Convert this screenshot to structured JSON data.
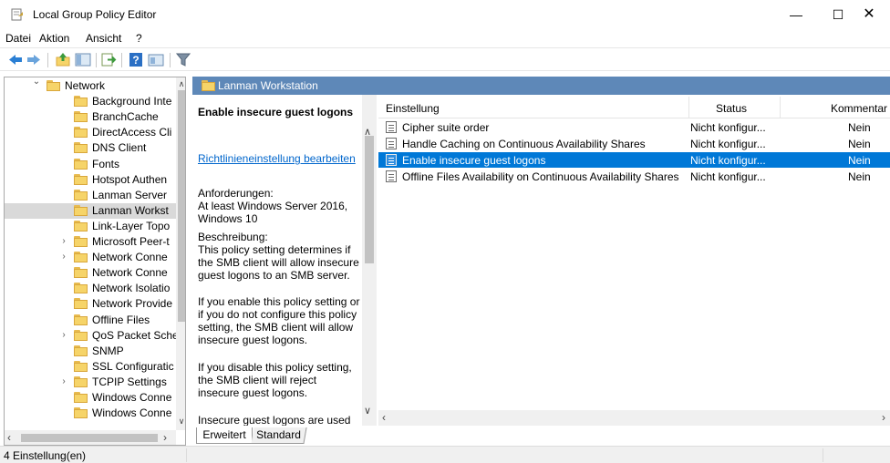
{
  "window": {
    "title": "Local Group Policy Editor",
    "minimize": "—",
    "maximize": "☐",
    "close": "✕"
  },
  "menu": [
    "Datei",
    "Aktion",
    "Ansicht",
    "?"
  ],
  "tree": {
    "items": [
      {
        "label": "Network",
        "expander": "expanded",
        "indent": 0
      },
      {
        "label": "Background Inte",
        "expander": "none",
        "indent": 1
      },
      {
        "label": "BranchCache",
        "expander": "none",
        "indent": 1
      },
      {
        "label": "DirectAccess Cli",
        "expander": "none",
        "indent": 1
      },
      {
        "label": "DNS Client",
        "expander": "none",
        "indent": 1
      },
      {
        "label": "Fonts",
        "expander": "none",
        "indent": 1
      },
      {
        "label": "Hotspot Authen",
        "expander": "none",
        "indent": 1
      },
      {
        "label": "Lanman Server",
        "expander": "none",
        "indent": 1
      },
      {
        "label": "Lanman Workst",
        "expander": "none",
        "indent": 1,
        "selected": true
      },
      {
        "label": "Link-Layer Topo",
        "expander": "none",
        "indent": 1
      },
      {
        "label": "Microsoft Peer-t",
        "expander": "collapsed",
        "indent": 1
      },
      {
        "label": "Network Conne",
        "expander": "collapsed",
        "indent": 1
      },
      {
        "label": "Network Conne",
        "expander": "none",
        "indent": 1
      },
      {
        "label": "Network Isolatio",
        "expander": "none",
        "indent": 1
      },
      {
        "label": "Network Provide",
        "expander": "none",
        "indent": 1
      },
      {
        "label": "Offline Files",
        "expander": "none",
        "indent": 1
      },
      {
        "label": "QoS Packet Sche",
        "expander": "collapsed",
        "indent": 1
      },
      {
        "label": "SNMP",
        "expander": "none",
        "indent": 1
      },
      {
        "label": "SSL Configuratic",
        "expander": "none",
        "indent": 1
      },
      {
        "label": "TCPIP Settings",
        "expander": "collapsed",
        "indent": 1
      },
      {
        "label": "Windows Conne",
        "expander": "none",
        "indent": 1
      },
      {
        "label": "Windows Conne",
        "expander": "none",
        "indent": 1
      }
    ]
  },
  "right_header": "Lanman Workstation",
  "description": {
    "title": "Enable insecure guest logons",
    "edit_link": "Richtlinieneinstellung bearbeiten",
    "requirements_label": "Anforderungen:",
    "requirements": "At least Windows Server 2016, Windows 10",
    "description_label": "Beschreibung:",
    "para1": "This policy setting determines if the SMB client will allow insecure guest logons to an SMB server.",
    "para2": "If you enable this policy setting or if you do not configure this policy setting, the SMB client will allow insecure guest logons.",
    "para3": "If you disable this policy setting, the SMB client will reject insecure guest logons.",
    "para4": "Insecure guest logons are used by file servers to allow unauthenticated access to shared"
  },
  "list": {
    "columns": [
      "Einstellung",
      "Status",
      "Kommentar"
    ],
    "rows": [
      {
        "setting": "Cipher suite order",
        "status": "Nicht konfigur...",
        "comment": "Nein"
      },
      {
        "setting": "Handle Caching on Continuous Availability Shares",
        "status": "Nicht konfigur...",
        "comment": "Nein"
      },
      {
        "setting": "Enable insecure guest logons",
        "status": "Nicht konfigur...",
        "comment": "Nein",
        "selected": true
      },
      {
        "setting": "Offline Files Availability on Continuous Availability Shares",
        "status": "Nicht konfigur...",
        "comment": "Nein"
      }
    ]
  },
  "tabs": [
    "Erweitert",
    "Standard"
  ],
  "active_tab": "Erweitert",
  "status": "4 Einstellung(en)",
  "colors": {
    "header_bar": "#5e88b8",
    "selection": "#0078d7",
    "link": "#0066cc"
  }
}
